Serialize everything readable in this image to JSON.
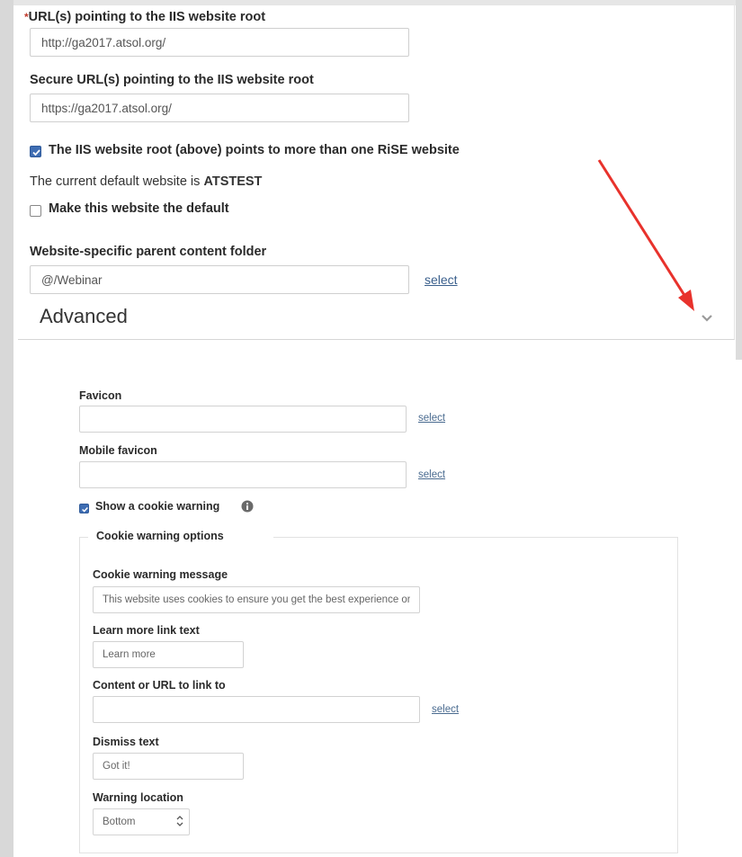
{
  "main": {
    "url_label": "URL(s) pointing to the IIS website root",
    "url_value": "http://ga2017.atsol.org/",
    "secure_url_label": "Secure URL(s) pointing to the IIS website root",
    "secure_url_value": "https://ga2017.atsol.org/",
    "multi_site_label": "The IIS website root (above) points to more than one RiSE website",
    "multi_site_checked": true,
    "default_prefix": "The current default website is ",
    "default_site": "ATSTEST",
    "make_default_label": "Make this website the default",
    "make_default_checked": false,
    "parent_folder_label": "Website-specific parent content folder",
    "parent_folder_value": "@/Webinar",
    "parent_folder_select": "select",
    "advanced_title": "Advanced"
  },
  "advanced": {
    "favicon_label": "Favicon",
    "favicon_value": "",
    "favicon_select": "select",
    "mobile_favicon_label": "Mobile favicon",
    "mobile_favicon_value": "",
    "mobile_favicon_select": "select",
    "cookie_warning_label": "Show a cookie warning",
    "cookie_warning_checked": true
  },
  "cookie_options": {
    "legend": "Cookie warning options",
    "message_label": "Cookie warning message",
    "message_value": "This website uses cookies to ensure you get the best experience on our website",
    "learn_more_label": "Learn more link text",
    "learn_more_value": "Learn more",
    "link_label": "Content or URL to link to",
    "link_value": "",
    "link_select": "select",
    "dismiss_label": "Dismiss text",
    "dismiss_value": "Got it!",
    "location_label": "Warning location",
    "location_value": "Bottom"
  },
  "colors": {
    "checkbox": "#3e6db3",
    "link": "#3a5f8c",
    "annotation_arrow": "#e8322c",
    "required": "#c0392b"
  }
}
